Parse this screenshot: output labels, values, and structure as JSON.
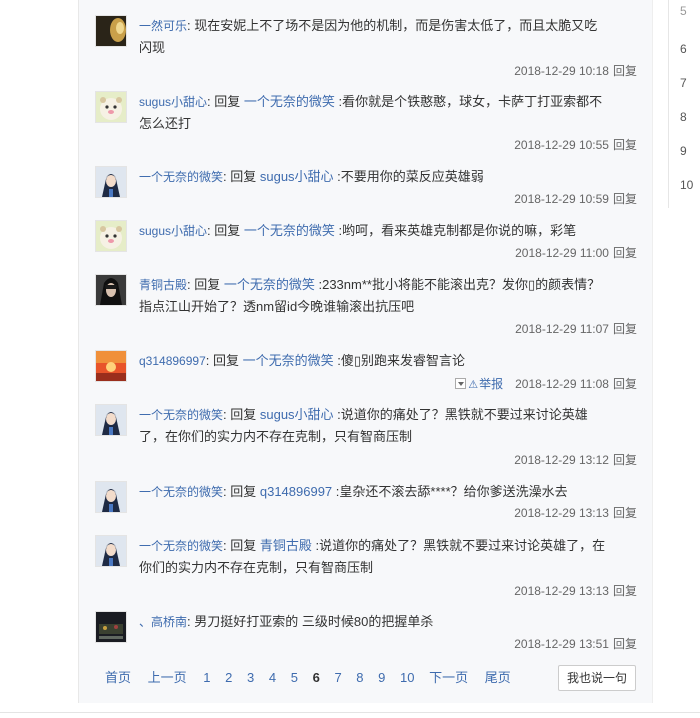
{
  "right_page_numbers": [
    "6",
    "7",
    "8",
    "9",
    "10"
  ],
  "right_top_partial": "5",
  "comments": [
    {
      "user": "一然可乐",
      "reply_word": "",
      "reply_to": "",
      "content_line1": ": 现在安妮上不了场不是因为他的机制，而是伤害太低了，而且太脆又吃",
      "content_line2": "闪现",
      "time": "2018-12-29 10:18",
      "report": "",
      "reply": "回复",
      "avatar": "dark-portrait"
    },
    {
      "user": "sugus小甜心",
      "reply_word": ": 回复 ",
      "reply_to": "一个无奈的微笑",
      "content_line1": " :看你就是个铁憨憨，球女，卡萨丁打亚索都不",
      "content_line2": "怎么还打",
      "time": "2018-12-29 10:55",
      "report": "",
      "reply": "回复",
      "avatar": "cute-animal"
    },
    {
      "user": "一个无奈的微笑",
      "reply_word": ": 回复 ",
      "reply_to": "sugus小甜心",
      "content_line1": " :不要用你的菜反应英雄弱",
      "content_line2": "",
      "time": "2018-12-29 10:59",
      "report": "",
      "reply": "回复",
      "avatar": "anime-character"
    },
    {
      "user": "sugus小甜心",
      "reply_word": ": 回复 ",
      "reply_to": "一个无奈的微笑",
      "content_line1": " :哟呵，看来英雄克制都是你说的嘛，彩笔",
      "content_line2": "",
      "time": "2018-12-29 11:00",
      "report": "",
      "reply": "回复",
      "avatar": "cute-animal"
    },
    {
      "user": "青铜古殿",
      "reply_word": ": 回复 ",
      "reply_to": "一个无奈的微笑",
      "content_line1": " :233nm**批小将能不能滚出克？发你▯的颜表情？",
      "content_line2": "指点江山开始了？透nm留id今晚谁输滚出抗压吧",
      "time": "2018-12-29 11:07",
      "report": "",
      "reply": "回复",
      "avatar": "dark-character"
    },
    {
      "user": "q314896997",
      "reply_word": ": 回复 ",
      "reply_to": "一个无奈的微笑",
      "content_line1": " :傻▯别跑来发睿智言论",
      "content_line2": "",
      "time": "2018-12-29 11:08",
      "report": "举报",
      "reply": "回复",
      "avatar": "sunset"
    },
    {
      "user": "一个无奈的微笑",
      "reply_word": ": 回复 ",
      "reply_to": "sugus小甜心",
      "content_line1": " :说道你的痛处了？黑铁就不要过来讨论英雄",
      "content_line2": "了，在你们的实力内不存在克制，只有智商压制",
      "time": "2018-12-29 13:12",
      "report": "",
      "reply": "回复",
      "avatar": "anime-character"
    },
    {
      "user": "一个无奈的微笑",
      "reply_word": ": 回复 ",
      "reply_to": "q314896997",
      "content_line1": " :皇杂还不滚去舔****？给你爹送洗澡水去",
      "content_line2": "",
      "time": "2018-12-29 13:13",
      "report": "",
      "reply": "回复",
      "avatar": "anime-character"
    },
    {
      "user": "一个无奈的微笑",
      "reply_word": ": 回复 ",
      "reply_to": "青铜古殿",
      "content_line1": " :说道你的痛处了？黑铁就不要过来讨论英雄了，在",
      "content_line2": "你们的实力内不存在克制，只有智商压制",
      "time": "2018-12-29 13:13",
      "report": "",
      "reply": "回复",
      "avatar": "anime-character"
    },
    {
      "user": "、高桥南",
      "reply_word": ": ",
      "reply_to": "",
      "content_line1": "男刀挺好打亚索的 三级时候80的把握单杀",
      "content_line2": "",
      "time": "2018-12-29 13:51",
      "report": "",
      "reply": "回复",
      "avatar": "game-scene"
    }
  ],
  "pagination": {
    "first": "首页",
    "prev": "上一页",
    "pages": [
      "1",
      "2",
      "3",
      "4",
      "5",
      "6",
      "7",
      "8",
      "9",
      "10"
    ],
    "current": "6",
    "next": "下一页",
    "last": "尾页"
  },
  "say_button": "我也说一句"
}
